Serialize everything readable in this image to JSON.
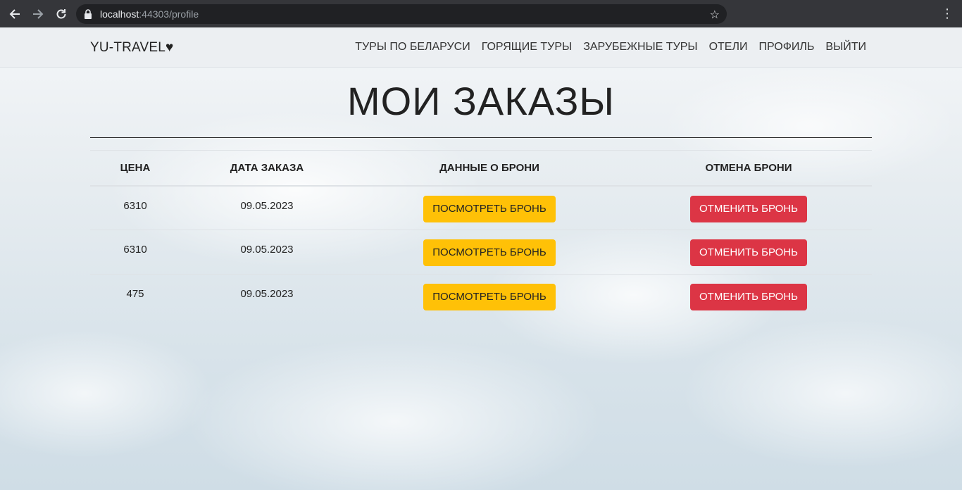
{
  "browser": {
    "url_host": "localhost",
    "url_rest": ":44303/profile",
    "back_icon": "arrow-left-icon",
    "forward_icon": "arrow-right-icon",
    "reload_icon": "reload-icon",
    "bookmark_icon": "star-icon",
    "menu_icon": "kebab-menu-icon"
  },
  "navbar": {
    "brand": "YU-TRAVEL♥",
    "links": [
      "ТУРЫ ПО БЕЛАРУСИ",
      "ГОРЯЩИЕ ТУРЫ",
      "ЗАРУБЕЖНЫЕ ТУРЫ",
      "ОТЕЛИ",
      "ПРОФИЛЬ",
      "ВЫЙТИ"
    ]
  },
  "page": {
    "title": "МОИ ЗАКАЗЫ"
  },
  "orders": {
    "headers": [
      "ЦЕНА",
      "ДАТА ЗАКАЗА",
      "ДАННЫЕ О БРОНИ",
      "ОТМЕНА БРОНИ"
    ],
    "rows": [
      {
        "price": "6310",
        "date": "09.05.2023",
        "view_label": "ПОСМОТРЕТЬ БРОНЬ",
        "cancel_label": "ОТМЕНИТЬ БРОНЬ"
      },
      {
        "price": "6310",
        "date": "09.05.2023",
        "view_label": "ПОСМОТРЕТЬ БРОНЬ",
        "cancel_label": "ОТМЕНИТЬ БРОНЬ"
      },
      {
        "price": "475",
        "date": "09.05.2023",
        "view_label": "ПОСМОТРЕТЬ БРОНЬ",
        "cancel_label": "ОТМЕНИТЬ БРОНЬ"
      }
    ]
  },
  "colors": {
    "view_button": "#ffc107",
    "cancel_button": "#dc3545"
  }
}
